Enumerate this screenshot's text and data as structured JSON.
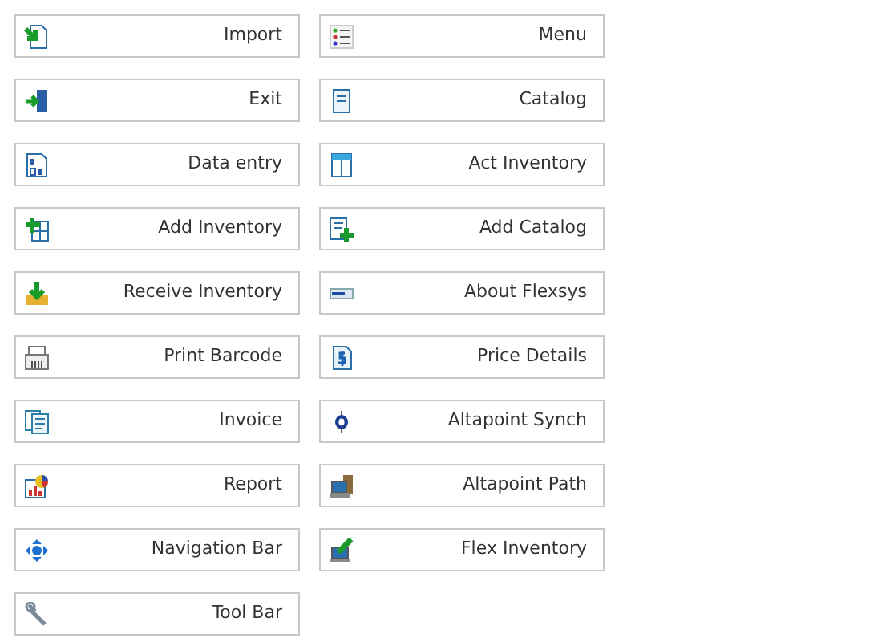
{
  "buttons": [
    {
      "label": "Import"
    },
    {
      "label": "Menu"
    },
    {
      "label": "Exit"
    },
    {
      "label": "Catalog"
    },
    {
      "label": "Data entry"
    },
    {
      "label": "Act Inventory"
    },
    {
      "label": "Add Inventory"
    },
    {
      "label": "Add Catalog"
    },
    {
      "label": "Receive Inventory"
    },
    {
      "label": "About Flexsys"
    },
    {
      "label": "Print Barcode"
    },
    {
      "label": "Price Details"
    },
    {
      "label": "Invoice"
    },
    {
      "label": "Altapoint Synch"
    },
    {
      "label": "Report"
    },
    {
      "label": "Altapoint Path"
    },
    {
      "label": "Navigation Bar"
    },
    {
      "label": "Flex Inventory"
    },
    {
      "label": "Tool Bar"
    }
  ]
}
